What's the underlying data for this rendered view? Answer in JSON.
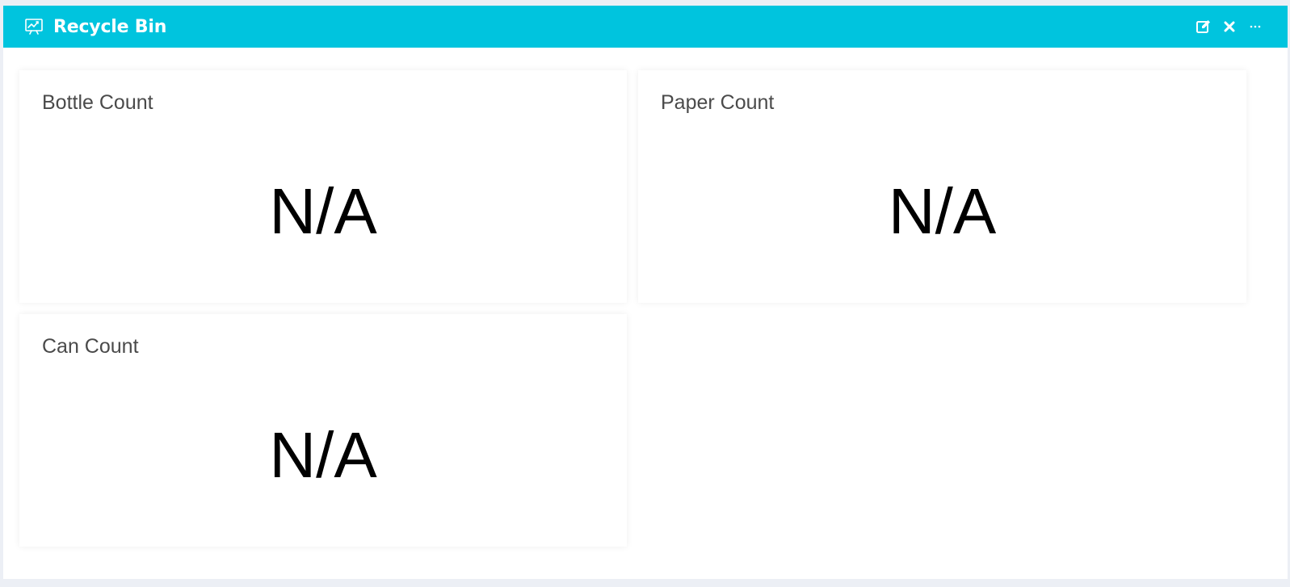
{
  "panel": {
    "title": "Recycle Bin",
    "title_icon": "presentation-chart-icon",
    "actions": [
      {
        "name": "edit",
        "icon": "edit-icon"
      },
      {
        "name": "close",
        "icon": "close-icon"
      },
      {
        "name": "more",
        "icon": "ellipsis-icon"
      }
    ]
  },
  "cards": [
    {
      "title": "Bottle Count",
      "value": "N/A"
    },
    {
      "title": "Paper Count",
      "value": "N/A"
    },
    {
      "title": "Can Count",
      "value": "N/A"
    }
  ],
  "colors": {
    "header": "#00c4de",
    "background": "#eceff5",
    "card_title": "#4a4a4a"
  }
}
